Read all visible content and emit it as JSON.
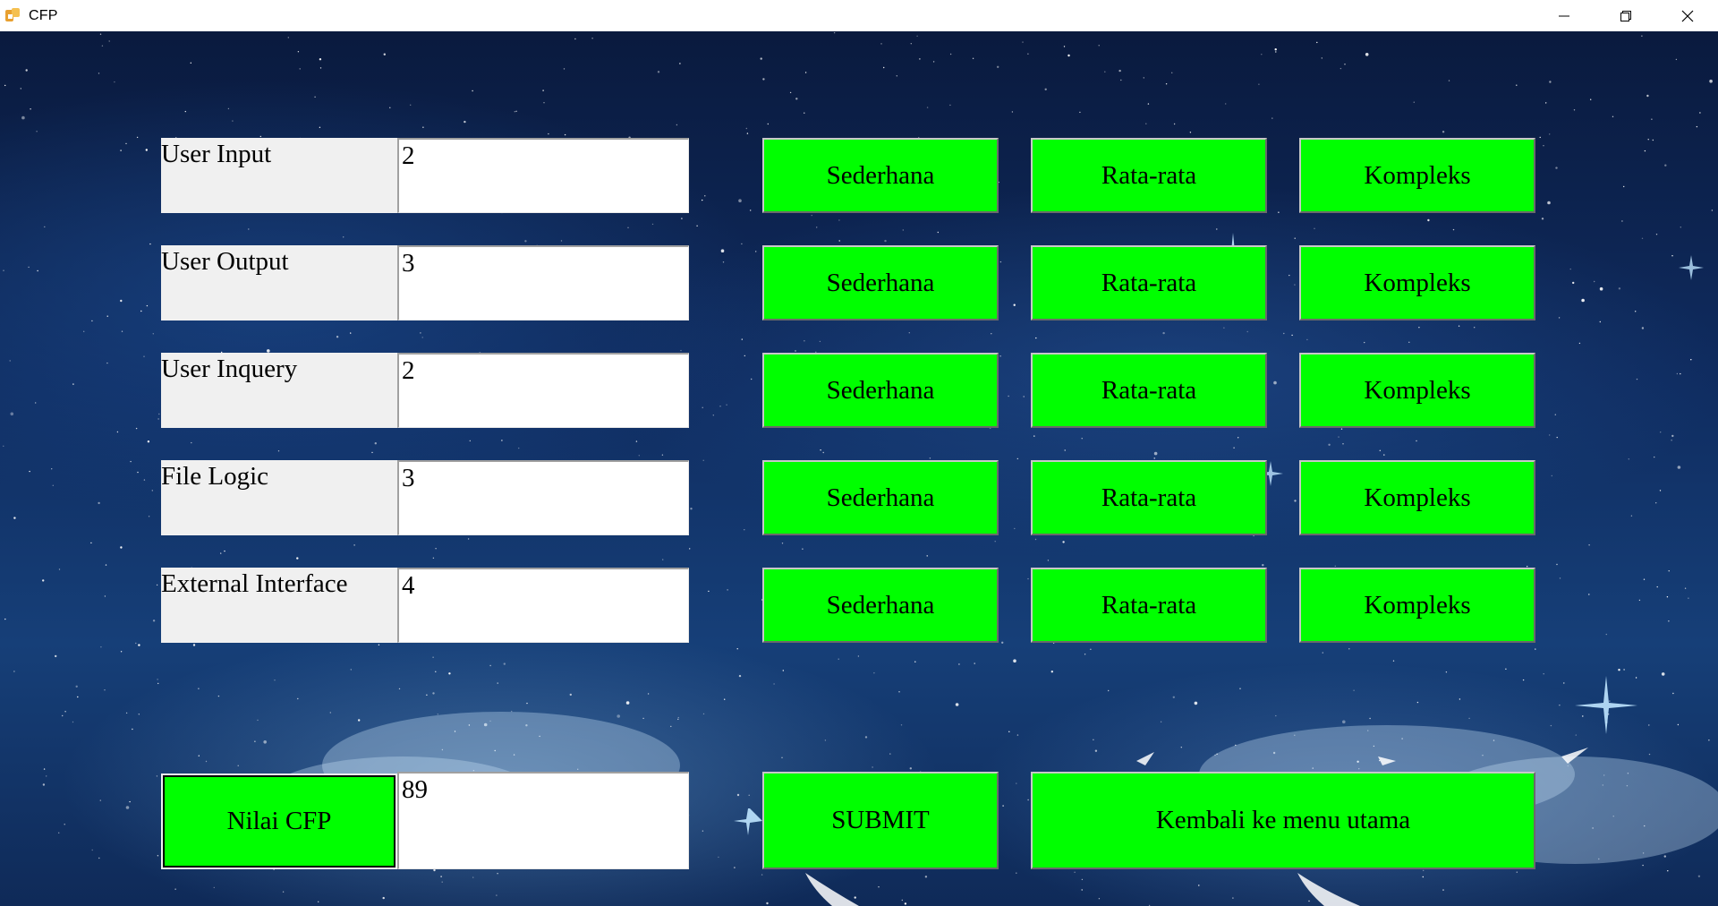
{
  "window": {
    "title": "CFP"
  },
  "fields": [
    {
      "label": "User Input",
      "value": "2"
    },
    {
      "label": "User Output",
      "value": "3"
    },
    {
      "label": "User Inquery",
      "value": "2"
    },
    {
      "label": "File Logic",
      "value": "3"
    },
    {
      "label": "External Interface",
      "value": "4"
    }
  ],
  "complexity_buttons": {
    "simple": "Sederhana",
    "average": "Rata-rata",
    "complex": "Kompleks"
  },
  "cfp": {
    "button_label": "Nilai CFP",
    "value": "89"
  },
  "actions": {
    "submit_label": "SUBMIT",
    "back_label": "Kembali ke menu utama"
  },
  "colors": {
    "button_green": "#00ff00",
    "label_background": "#f0f0f0",
    "sky_background": "#0f2c60"
  }
}
